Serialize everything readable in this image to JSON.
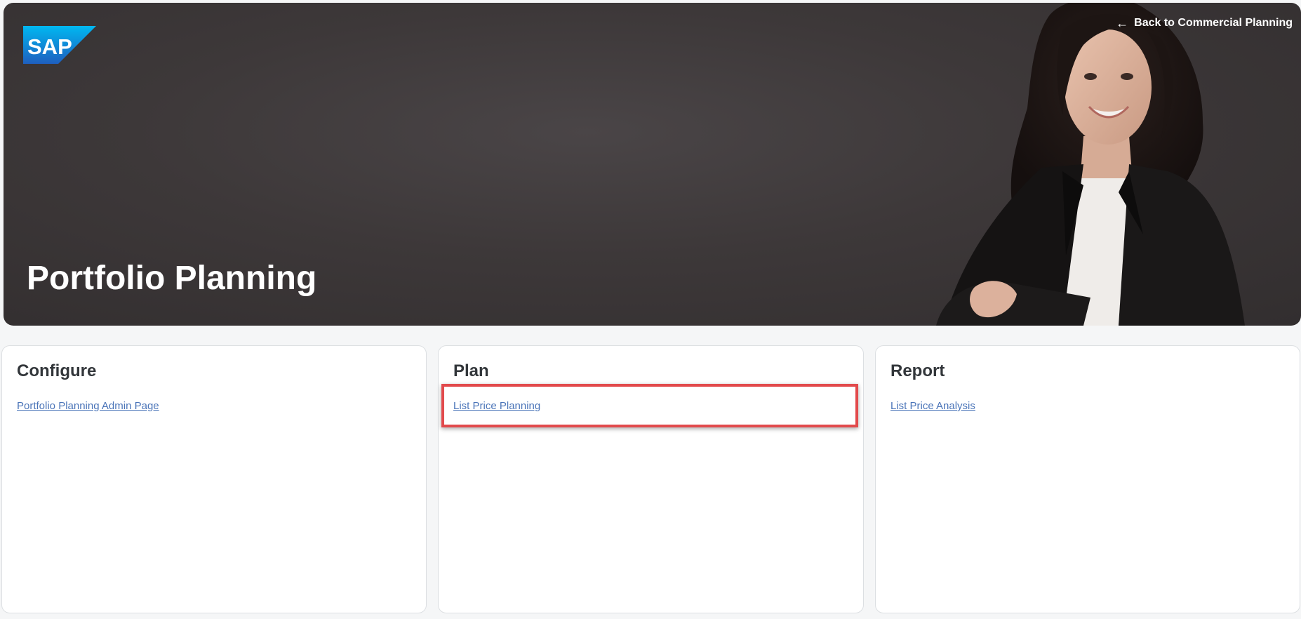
{
  "hero": {
    "logo_text": "SAP",
    "back_link_label": "Back to Commercial Planning",
    "title": "Portfolio Planning"
  },
  "cards": [
    {
      "title": "Configure",
      "link": "Portfolio Planning Admin Page"
    },
    {
      "title": "Plan",
      "link": "List Price Planning"
    },
    {
      "title": "Report",
      "link": "List Price Analysis"
    }
  ],
  "colors": {
    "hero_bg": "#3d3839",
    "link": "#4a74b8",
    "highlight": "#e24a4c",
    "sap_blue": "#0a6ed1"
  },
  "icons": {
    "back": "arrow-left-icon"
  }
}
